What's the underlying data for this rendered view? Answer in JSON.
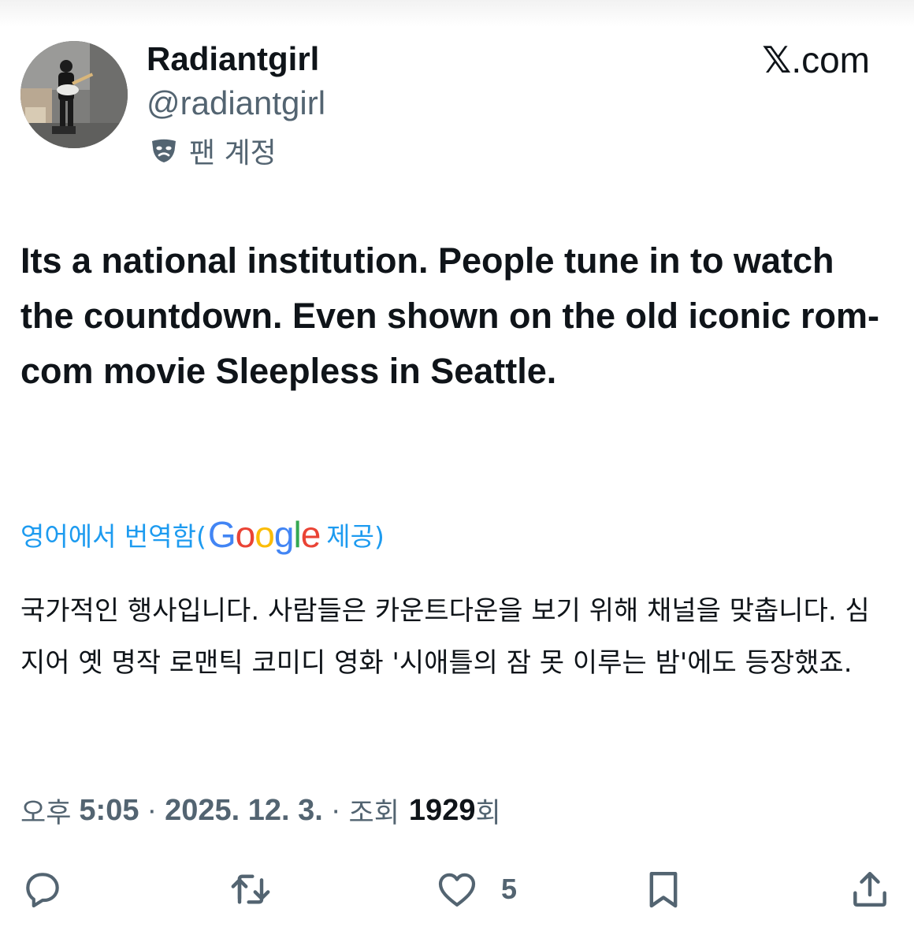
{
  "author": {
    "display_name": "Radiantgirl",
    "handle": "@radiantgirl",
    "badge_icon": "theater-masks-icon",
    "badge_label": "팬 계정"
  },
  "site_label": {
    "x": "𝕏",
    "rest": ".com"
  },
  "tweet": {
    "text": "Its a national institution. People tune in to watch the countdown. Even shown on the old iconic rom-com movie Sleepless in Seattle."
  },
  "translation": {
    "prefix": "영어에서 번역함(",
    "google": [
      "G",
      "o",
      "o",
      "g",
      "l",
      "e"
    ],
    "suffix": "제공)",
    "text": "국가적인 행사입니다. 사람들은 카운트다운을 보기 위해 채널을 맞춥니다. 심지어 옛 명작 로맨틱 코미디 영화 '시애틀의 잠 못 이루는 밤'에도 등장했죠."
  },
  "meta": {
    "ampm": "오후",
    "time": "5:05",
    "dot1": "·",
    "date": "2025. 12. 3.",
    "dot2": "·",
    "views_label": "조회",
    "views_count": "1929",
    "views_unit": "회"
  },
  "actions": {
    "reply_icon": "reply-icon",
    "retweet_icon": "retweet-icon",
    "like_icon": "heart-icon",
    "like_count": "5",
    "bookmark_icon": "bookmark-icon",
    "share_icon": "share-icon"
  },
  "colors": {
    "link_blue": "#1d9bf0",
    "muted_gray": "#536471",
    "text_dark": "#0f1419",
    "google_blue": "#4285f4",
    "google_red": "#ea4335",
    "google_yellow": "#fbbc05",
    "google_green": "#34a853"
  }
}
